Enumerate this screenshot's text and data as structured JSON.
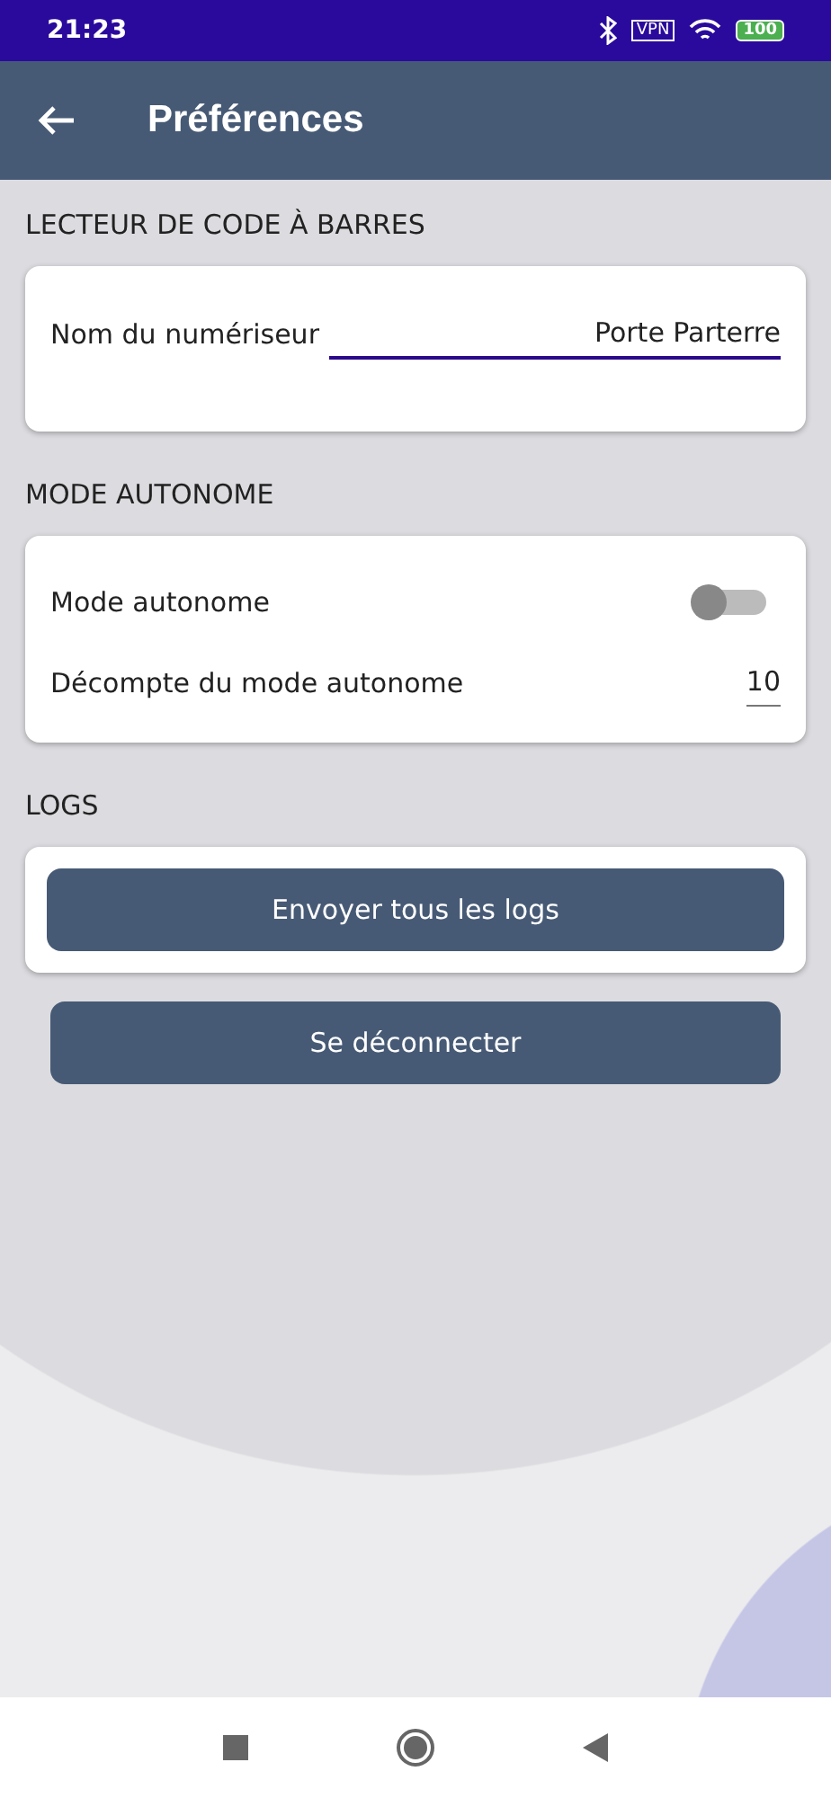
{
  "status_bar": {
    "time": "21:23",
    "vpn": "VPN",
    "battery": "100"
  },
  "app_bar": {
    "title": "Préférences"
  },
  "sections": [
    {
      "title": "LECTEUR DE CODE À BARRES",
      "rows": [
        {
          "kind": "text",
          "label": "Nom du numériseur",
          "value": "Porte Parterre",
          "focused": true
        }
      ]
    },
    {
      "title": "MODE AUTONOME",
      "rows": [
        {
          "kind": "switch",
          "label": "Mode autonome",
          "on": false
        },
        {
          "kind": "number",
          "label": "Décompte du mode autonome",
          "value": "10",
          "focused": false
        }
      ]
    },
    {
      "title": "LOGS",
      "rows": [
        {
          "kind": "button",
          "label": "Envoyer tous les logs"
        }
      ]
    }
  ],
  "footer_button": "Se déconnecter"
}
